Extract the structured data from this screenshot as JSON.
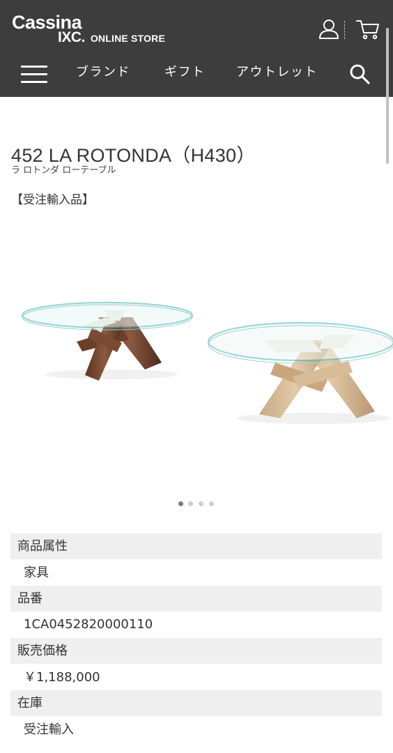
{
  "header": {
    "logo_line1": "Cassina",
    "logo_line2": "IXC.",
    "logo_store": "ONLINE STORE",
    "bg_color": "#3d3d3d"
  },
  "nav": {
    "items": [
      "ブランド",
      "ギフト",
      "アウトレット"
    ],
    "icons": [
      "menu-icon",
      "search-icon",
      "user-icon",
      "cart-icon"
    ]
  },
  "product": {
    "title": "452 LA ROTONDA（H430）",
    "subtitle": "ラ ロトンダ ローテーブル",
    "import_label": "【受注輸入品】",
    "image_description_icons": [
      "walnut-table",
      "ash-table"
    ],
    "carousel": {
      "total": 4,
      "active": 1
    }
  },
  "specs": [
    {
      "label": "商品属性",
      "value": "家具"
    },
    {
      "label": "品番",
      "value": "1CA0452820000110"
    },
    {
      "label": "販売価格",
      "value": "￥1,188,000"
    },
    {
      "label": "在庫",
      "value": "受注輸入"
    }
  ],
  "colors": {
    "spec_bg": "#efefef",
    "text": "#333333",
    "header_text": "#ffffff"
  }
}
